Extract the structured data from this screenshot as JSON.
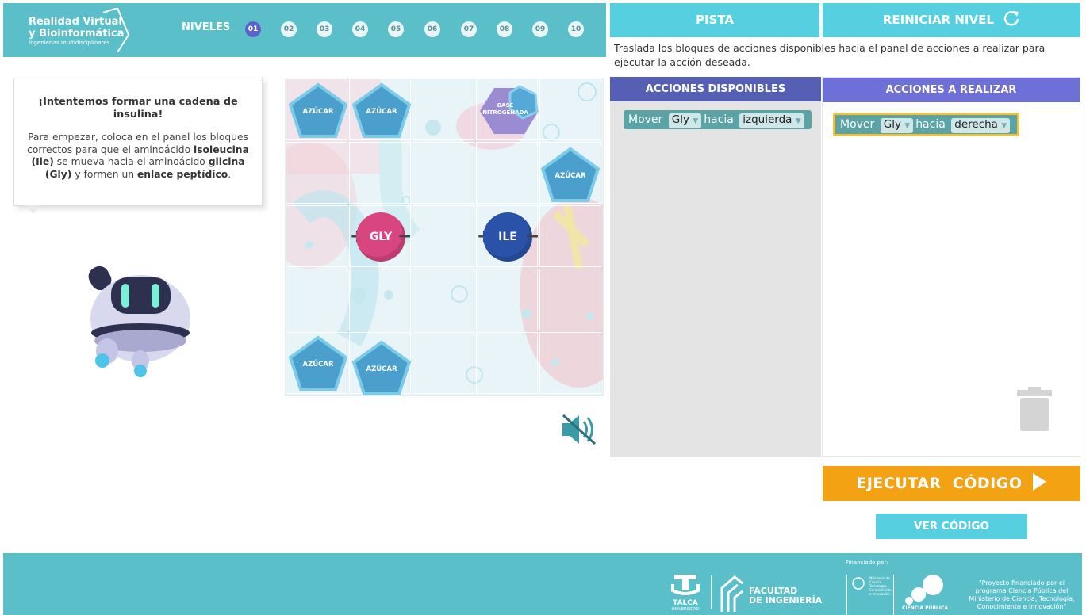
{
  "header": {
    "logo_line1": "Realidad Virtual",
    "logo_line2": "y Bioinformática",
    "logo_sub": "Ingenierías multidisciplinares",
    "levels_label": "NIVELES",
    "levels": [
      "01",
      "02",
      "03",
      "04",
      "05",
      "06",
      "07",
      "08",
      "09",
      "10"
    ],
    "active_level": "01"
  },
  "buttons": {
    "hint": "PISTA",
    "restart": "REINICIAR NIVEL",
    "execute": "EJECUTAR  CÓDIGO",
    "view_code": "VER CÓDIGO"
  },
  "instructions": "Traslada los bloques de acciones disponibles hacia el panel de acciones a realizar para ejecutar la acción deseada.",
  "bubble": {
    "title": "¡Intentemos formar una cadena de insulina!",
    "p1": "Para empezar, coloca en el panel los bloques correctos para que el aminoácido ",
    "b1": "isoleucina (Ile)",
    "p2": " se mueva hacia el aminoácido ",
    "b2": "glicina (Gly)",
    "p3": " y formen un ",
    "b3": "enlace peptídico",
    "p4": "."
  },
  "board": {
    "sugar_label": "AZÚCAR",
    "base_label": "BASE NITROGENADA",
    "gly_label": "GLY",
    "ile_label": "ILE"
  },
  "panels": {
    "available_title": "ACCIONES DISPONIBLES",
    "todo_title": "ACCIONES A REALIZAR",
    "available_block": {
      "verb": "Mover",
      "subject": "Gly",
      "prep": "hacia",
      "direction": "izquierda"
    },
    "todo_block": {
      "verb": "Mover",
      "subject": "Gly",
      "prep": "hacia",
      "direction": "derecha"
    }
  },
  "footer": {
    "talca": "TALCA",
    "talca_sub": "UNIVERSIDAD",
    "faculty1": "FACULTAD",
    "faculty2": "DE INGENIERÍA",
    "funded_by": "Financiado por:",
    "ministry": "Ministerio de Ciencia, Tecnología, Conocimiento e Innovación",
    "ciencia": "CIENCIA PÚBLICA",
    "project": "\"Proyecto financiado por el programa Ciencia Pública del Ministerio de Ciencia, Tecnología, Conocimiento e Innovación\""
  },
  "colors": {
    "teal": "#5bbfca",
    "button": "#56cfe0",
    "panel_header": "#5560b5",
    "execute": "#f3a214",
    "gly": "#d9467f",
    "ile": "#2a52a8"
  }
}
